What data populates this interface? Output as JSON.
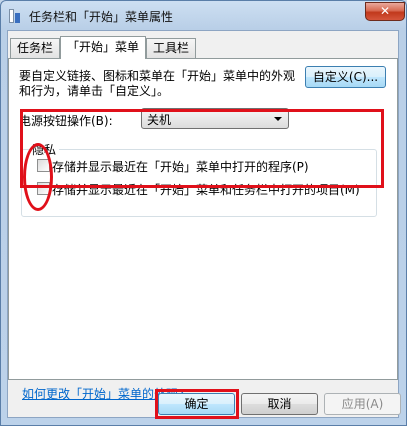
{
  "window": {
    "title": "任务栏和「开始」菜单属性",
    "close_label": "✕"
  },
  "tabs": [
    {
      "label": "任务栏"
    },
    {
      "label": "「开始」菜单"
    },
    {
      "label": "工具栏"
    }
  ],
  "panel": {
    "description": "要自定义链接、图标和菜单在「开始」菜单中的外观和行为，请单击「自定义」。",
    "customize_button": "自定义(C)...",
    "power_label": "电源按钮操作(B):",
    "power_value": "关机",
    "privacy_title": "隐私",
    "checkbox1": "存储并显示最近在「开始」菜单中打开的程序(P)",
    "checkbox2": "存储并显示最近在「开始」菜单和任务栏中打开的项目(M)",
    "help_link": "如何更改「开始」菜单的外观?"
  },
  "footer": {
    "ok": "确定",
    "cancel": "取消",
    "apply": "应用(A)"
  },
  "colors": {
    "highlight": "#e0101a",
    "link": "#0066cc"
  }
}
